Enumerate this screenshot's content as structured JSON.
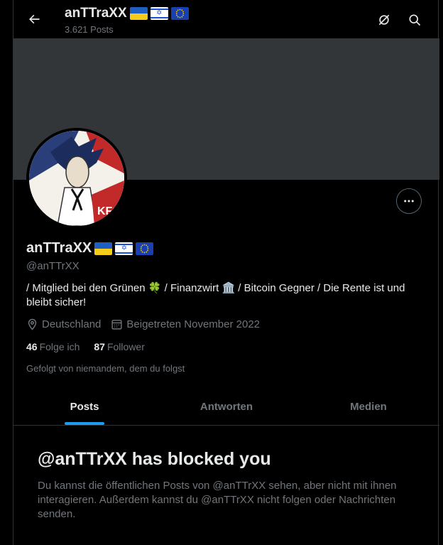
{
  "header": {
    "name": "anTTraXX",
    "post_count": "3.621 Posts"
  },
  "profile": {
    "display_name": "anTTraXX",
    "handle": "@anTTrXX",
    "bio": "/ Mitglied bei den Grünen 🍀 / Finanzwirt 🏛️ / Bitcoin Gegner / Die Rente ist und bleibt sicher!",
    "location": "Deutschland",
    "joined": "Beigetreten November 2022",
    "following_count": "46",
    "following_label": "Folge ich",
    "followers_count": "87",
    "followers_label": "Follower",
    "followed_by": "Gefolgt von niemandem, dem du folgst",
    "avatar_text": "KFC"
  },
  "tabs": [
    {
      "label": "Posts",
      "active": true
    },
    {
      "label": "Antworten",
      "active": false
    },
    {
      "label": "Medien",
      "active": false
    }
  ],
  "blocked": {
    "title": "@anTTrXX has blocked you",
    "text": "Du kannst die öffentlichen Posts von @anTTrXX sehen, aber nicht mit ihnen interagieren. Außerdem kannst du @anTTrXX nicht folgen oder Nachrichten senden."
  },
  "colors": {
    "background": "#000000",
    "accent": "#1d9bf0",
    "muted_text": "#71767b",
    "banner": "#333639"
  },
  "icons": [
    "back-arrow-icon",
    "grok-icon",
    "search-icon",
    "more-icon",
    "location-pin-icon",
    "calendar-icon"
  ]
}
